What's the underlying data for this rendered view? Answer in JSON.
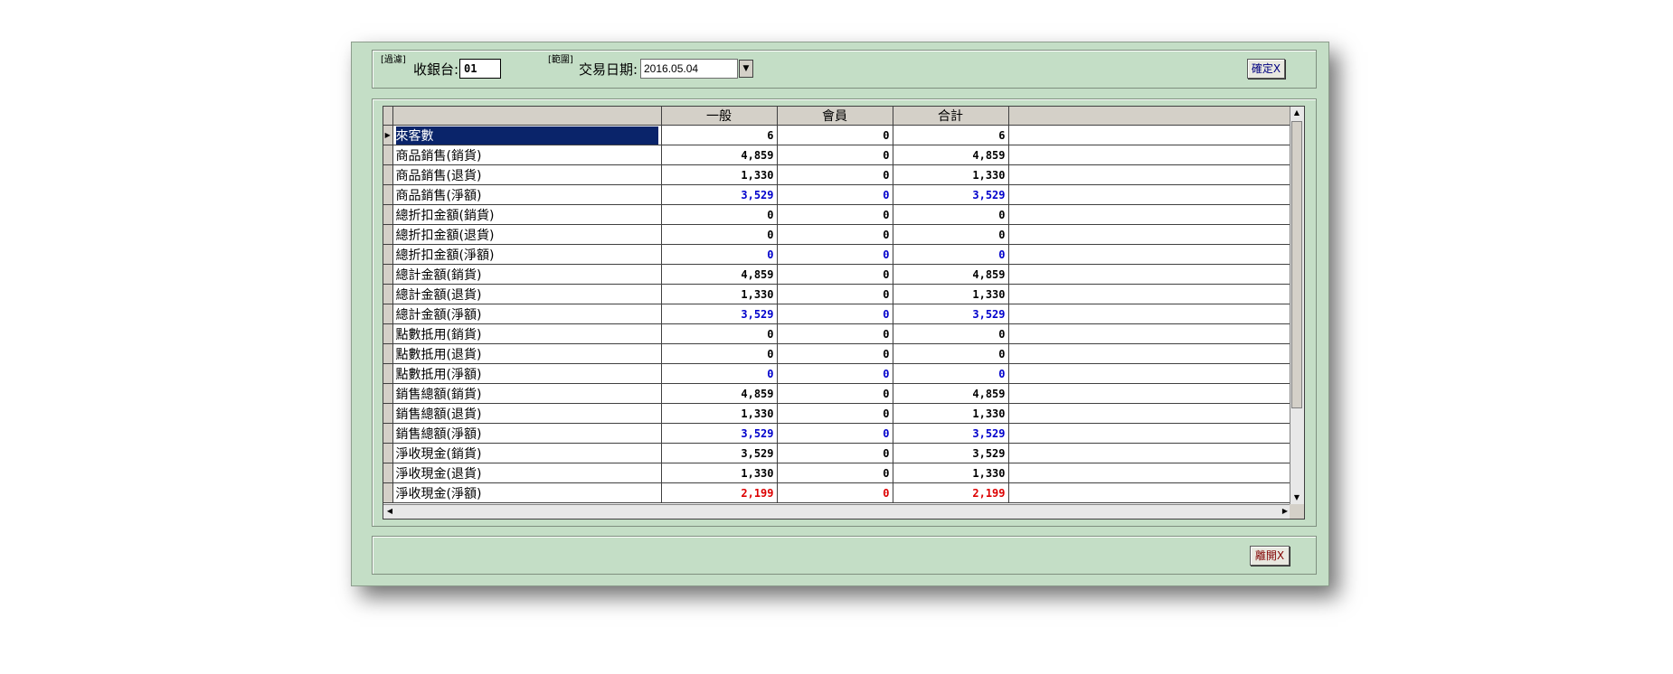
{
  "filter": {
    "filter_tag": "[過濾]",
    "register_label": "收銀台:",
    "register_value": "01",
    "range_tag": "[範圍]",
    "date_label": "交易日期:",
    "date_value": "2016.05.04",
    "confirm_label": "確定X"
  },
  "grid": {
    "columns": [
      "",
      "一般",
      "會員",
      "合計",
      ""
    ],
    "rows": [
      {
        "label": "來客數",
        "values": [
          "6",
          "0",
          "6"
        ],
        "color": "black"
      },
      {
        "label": "商品銷售(銷貨)",
        "values": [
          "4,859",
          "0",
          "4,859"
        ],
        "color": "black"
      },
      {
        "label": "商品銷售(退貨)",
        "values": [
          "1,330",
          "0",
          "1,330"
        ],
        "color": "black"
      },
      {
        "label": "商品銷售(淨額)",
        "values": [
          "3,529",
          "0",
          "3,529"
        ],
        "color": "blue"
      },
      {
        "label": "總折扣金額(銷貨)",
        "values": [
          "0",
          "0",
          "0"
        ],
        "color": "black"
      },
      {
        "label": "總折扣金額(退貨)",
        "values": [
          "0",
          "0",
          "0"
        ],
        "color": "black"
      },
      {
        "label": "總折扣金額(淨額)",
        "values": [
          "0",
          "0",
          "0"
        ],
        "color": "blue"
      },
      {
        "label": "總計金額(銷貨)",
        "values": [
          "4,859",
          "0",
          "4,859"
        ],
        "color": "black"
      },
      {
        "label": "總計金額(退貨)",
        "values": [
          "1,330",
          "0",
          "1,330"
        ],
        "color": "black"
      },
      {
        "label": "總計金額(淨額)",
        "values": [
          "3,529",
          "0",
          "3,529"
        ],
        "color": "blue"
      },
      {
        "label": "點數抵用(銷貨)",
        "values": [
          "0",
          "0",
          "0"
        ],
        "color": "black"
      },
      {
        "label": "點數抵用(退貨)",
        "values": [
          "0",
          "0",
          "0"
        ],
        "color": "black"
      },
      {
        "label": "點數抵用(淨額)",
        "values": [
          "0",
          "0",
          "0"
        ],
        "color": "blue"
      },
      {
        "label": "銷售總額(銷貨)",
        "values": [
          "4,859",
          "0",
          "4,859"
        ],
        "color": "black"
      },
      {
        "label": "銷售總額(退貨)",
        "values": [
          "1,330",
          "0",
          "1,330"
        ],
        "color": "black"
      },
      {
        "label": "銷售總額(淨額)",
        "values": [
          "3,529",
          "0",
          "3,529"
        ],
        "color": "blue"
      },
      {
        "label": "淨收現金(銷貨)",
        "values": [
          "3,529",
          "0",
          "3,529"
        ],
        "color": "black"
      },
      {
        "label": "淨收現金(退貨)",
        "values": [
          "1,330",
          "0",
          "1,330"
        ],
        "color": "black"
      },
      {
        "label": "淨收現金(淨額)",
        "values": [
          "2,199",
          "0",
          "2,199"
        ],
        "color": "red"
      }
    ]
  },
  "footer": {
    "exit_label": "離開X"
  },
  "colors": {
    "window_bg": "#c4dec6",
    "blue": "#0000cc",
    "red": "#dd0000",
    "selection": "#0a246a"
  }
}
